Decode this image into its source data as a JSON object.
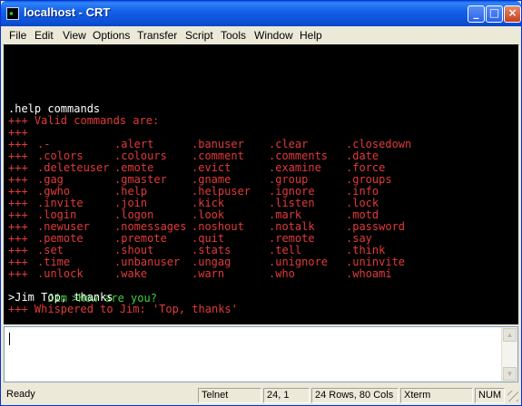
{
  "window": {
    "title": "localhost - CRT"
  },
  "titlebar": {
    "minimize": "_",
    "maximize": "□",
    "close": "×"
  },
  "menu": [
    "File",
    "Edit",
    "View",
    "Options",
    "Transfer",
    "Script",
    "Tools",
    "Window",
    "Help"
  ],
  "terminal": {
    "line1": ".help commands",
    "line2": "+++ Valid commands are:",
    "line3": "+++",
    "prefix": "+++",
    "grid": [
      [
        ".-",
        ".alert",
        ".banuser",
        ".clear",
        ".closedown"
      ],
      [
        ".colors",
        ".colours",
        ".comment",
        ".comments",
        ".date"
      ],
      [
        ".deleteuser",
        ".emote",
        ".evict",
        ".examine",
        ".force"
      ],
      [
        ".gag",
        ".gmaster",
        ".gname",
        ".group",
        ".groups"
      ],
      [
        ".gwho",
        ".help",
        ".helpuser",
        ".ignore",
        ".info"
      ],
      [
        ".invite",
        ".join",
        ".kick",
        ".listen",
        ".lock"
      ],
      [
        ".login",
        ".logon",
        ".look",
        ".mark",
        ".motd"
      ],
      [
        ".newuser",
        ".nomessages",
        ".noshout",
        ".notalk",
        ".password"
      ],
      [
        ".pemote",
        ".premote",
        ".quit",
        ".remote",
        ".say"
      ],
      [
        ".set",
        ".shout",
        ".stats",
        ".tell",
        ".think"
      ],
      [
        ".time",
        ".unbanuser",
        ".ungag",
        ".unignore",
        ".uninvite"
      ],
      [
        ".unlock",
        ".wake",
        ".warn",
        ".who",
        ".whoami"
      ]
    ],
    "jim_name": "Jim",
    "jim_msg": ">How are you?",
    "reply": ">Jim Top, thanks",
    "whisper": "+++ Whispered to Jim: 'Top, thanks'"
  },
  "status": {
    "ready": "Ready",
    "protocol": "Telnet",
    "position": "24,  1",
    "size": "24 Rows,  80 Cols",
    "emulation": "Xterm",
    "num": "NUM"
  },
  "colors": {
    "terminal_bg": "#000000",
    "red": "#e23a3a",
    "green": "#3fd43f",
    "title_blue": "#1461e8"
  }
}
